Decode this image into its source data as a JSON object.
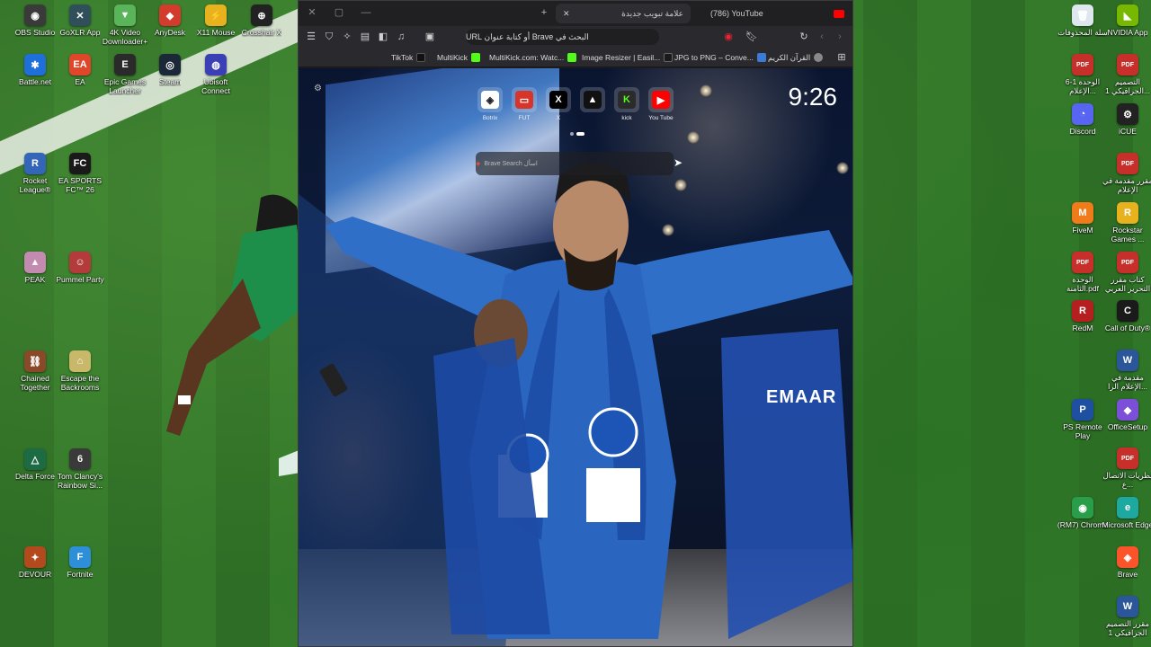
{
  "desktop": {
    "left_icons": [
      {
        "label": "OBS Studio",
        "color": "#3a3a3a",
        "glyph": "◉"
      },
      {
        "label": "GoXLR App",
        "color": "#2f4f5a",
        "glyph": "✕"
      },
      {
        "label": "4K Video Downloader+",
        "color": "#5ab45a",
        "glyph": "▼"
      },
      {
        "label": "AnyDesk",
        "color": "#d33b2c",
        "glyph": "◆"
      },
      {
        "label": "X11 Mouse",
        "color": "#e8b21f",
        "glyph": "⚡"
      },
      {
        "label": "Crosshair X",
        "color": "#222222",
        "glyph": "⊕"
      },
      {
        "label": "Battle.net",
        "color": "#1e6fd9",
        "glyph": "✱"
      },
      {
        "label": "EA",
        "color": "#e0462a",
        "glyph": "EA"
      },
      {
        "label": "Epic Games Launcher",
        "color": "#2a2a2a",
        "glyph": "E"
      },
      {
        "label": "Steam",
        "color": "#1b2838",
        "glyph": "◎"
      },
      {
        "label": "Ubisoft Connect",
        "color": "#3a3fb5",
        "glyph": "◍"
      },
      {
        "label": "Rocket League®",
        "color": "#3365b8",
        "glyph": "R"
      },
      {
        "label": "EA SPORTS FC™ 26",
        "color": "#1a1a1a",
        "glyph": "FC"
      },
      {
        "label": "PEAK",
        "color": "#c48bb0",
        "glyph": "▲"
      },
      {
        "label": "Pummel Party",
        "color": "#b33b3b",
        "glyph": "☺"
      },
      {
        "label": "Chained Together",
        "color": "#8a4a2a",
        "glyph": "⛓"
      },
      {
        "label": "Escape the Backrooms",
        "color": "#c8b86a",
        "glyph": "⌂"
      },
      {
        "label": "Delta Force",
        "color": "#1d6b45",
        "glyph": "△"
      },
      {
        "label": "Tom Clancy's Rainbow Si...",
        "color": "#3a3a3a",
        "glyph": "6"
      },
      {
        "label": "DEVOUR",
        "color": "#b34a1e",
        "glyph": "✦"
      },
      {
        "label": "Fortnite",
        "color": "#2e8fd9",
        "glyph": "F"
      }
    ],
    "right_icons": [
      {
        "label": "سلة المحذوفات",
        "color": "#dfe7ee",
        "glyph": "🗑"
      },
      {
        "label": "NVIDIA App",
        "color": "#76b900",
        "glyph": "◣"
      },
      {
        "label": "الوحدة 1-6 الإعلام...",
        "color": "#c7302a",
        "glyph": "PDF"
      },
      {
        "label": "التصميم الجرافيكي 1...",
        "color": "#c7302a",
        "glyph": "PDF"
      },
      {
        "label": "Discord",
        "color": "#5865f2",
        "glyph": "◔"
      },
      {
        "label": "iCUE",
        "color": "#222222",
        "glyph": "⚙"
      },
      {
        "label": "مقرر مقدمة في الإعلام",
        "color": "#c7302a",
        "glyph": "PDF"
      },
      {
        "label": "FiveM",
        "color": "#f07b1a",
        "glyph": "M"
      },
      {
        "label": "Rockstar Games ...",
        "color": "#e8b21f",
        "glyph": "R"
      },
      {
        "label": "الوحدة الثامنة.pdf",
        "color": "#c7302a",
        "glyph": "PDF"
      },
      {
        "label": "كتاب مقرر التحرير العربي",
        "color": "#c7302a",
        "glyph": "PDF"
      },
      {
        "label": "RedM",
        "color": "#b51f1f",
        "glyph": "R"
      },
      {
        "label": "Call of Duty®",
        "color": "#1a1a1a",
        "glyph": "C"
      },
      {
        "label": "مقدمة في الإعلام الرا...",
        "color": "#2b579a",
        "glyph": "W"
      },
      {
        "label": "PS Remote Play",
        "color": "#1f4fa0",
        "glyph": "P"
      },
      {
        "label": "OfficeSetup",
        "color": "#7b4fd8",
        "glyph": "◆"
      },
      {
        "label": "نظريات الاتصال ع...",
        "color": "#c7302a",
        "glyph": "PDF"
      },
      {
        "label": "(RM7) Chrome",
        "color": "#2a9d4a",
        "glyph": "◉"
      },
      {
        "label": "Microsoft Edge",
        "color": "#1da8a0",
        "glyph": "e"
      },
      {
        "label": "Brave",
        "color": "#fb542b",
        "glyph": "◈"
      },
      {
        "label": "مقرر التصميم الجرافيكي 1",
        "color": "#2b579a",
        "glyph": "W"
      }
    ]
  },
  "browser": {
    "tabs": [
      {
        "title": "علامة تبويب جديدة",
        "active": true
      },
      {
        "title": "(786) YouTube",
        "active": false
      }
    ],
    "url_placeholder": "البحث في Brave أو كتابة عنوان URL",
    "bookmarks": [
      {
        "label": "TikTok",
        "color": "#111111"
      },
      {
        "label": "MultiKick",
        "color": "#53fc18"
      },
      {
        "label": "MultiKick.com: Watc...",
        "color": "#53fc18"
      },
      {
        "label": "Image Resizer | Easil...",
        "color": "#1a1a1a"
      },
      {
        "label": "JPG to PNG – Conve...",
        "color": "#3a7bd5"
      },
      {
        "label": "القرآن الكريم",
        "color": "#888888"
      }
    ]
  },
  "newtab": {
    "clock": "9:26",
    "search_placeholder": "اسأل Brave Search",
    "tiles": [
      {
        "label": "Botrix",
        "color": "#ffffff",
        "glyph": "◈",
        "text_color": "#222"
      },
      {
        "label": "FUT",
        "color": "#d7342a",
        "glyph": "▭",
        "text_color": "#fff"
      },
      {
        "label": "X",
        "color": "#000000",
        "glyph": "X",
        "text_color": "#fff"
      },
      {
        "label": "",
        "color": "#111111",
        "glyph": "▲",
        "text_color": "#fff"
      },
      {
        "label": "kick",
        "color": "#2b2b2b",
        "glyph": "K",
        "text_color": "#53fc18"
      },
      {
        "label": "You Tube",
        "color": "#ff0000",
        "glyph": "▶",
        "text_color": "#fff"
      }
    ],
    "jersey_text": "EMAAR"
  }
}
